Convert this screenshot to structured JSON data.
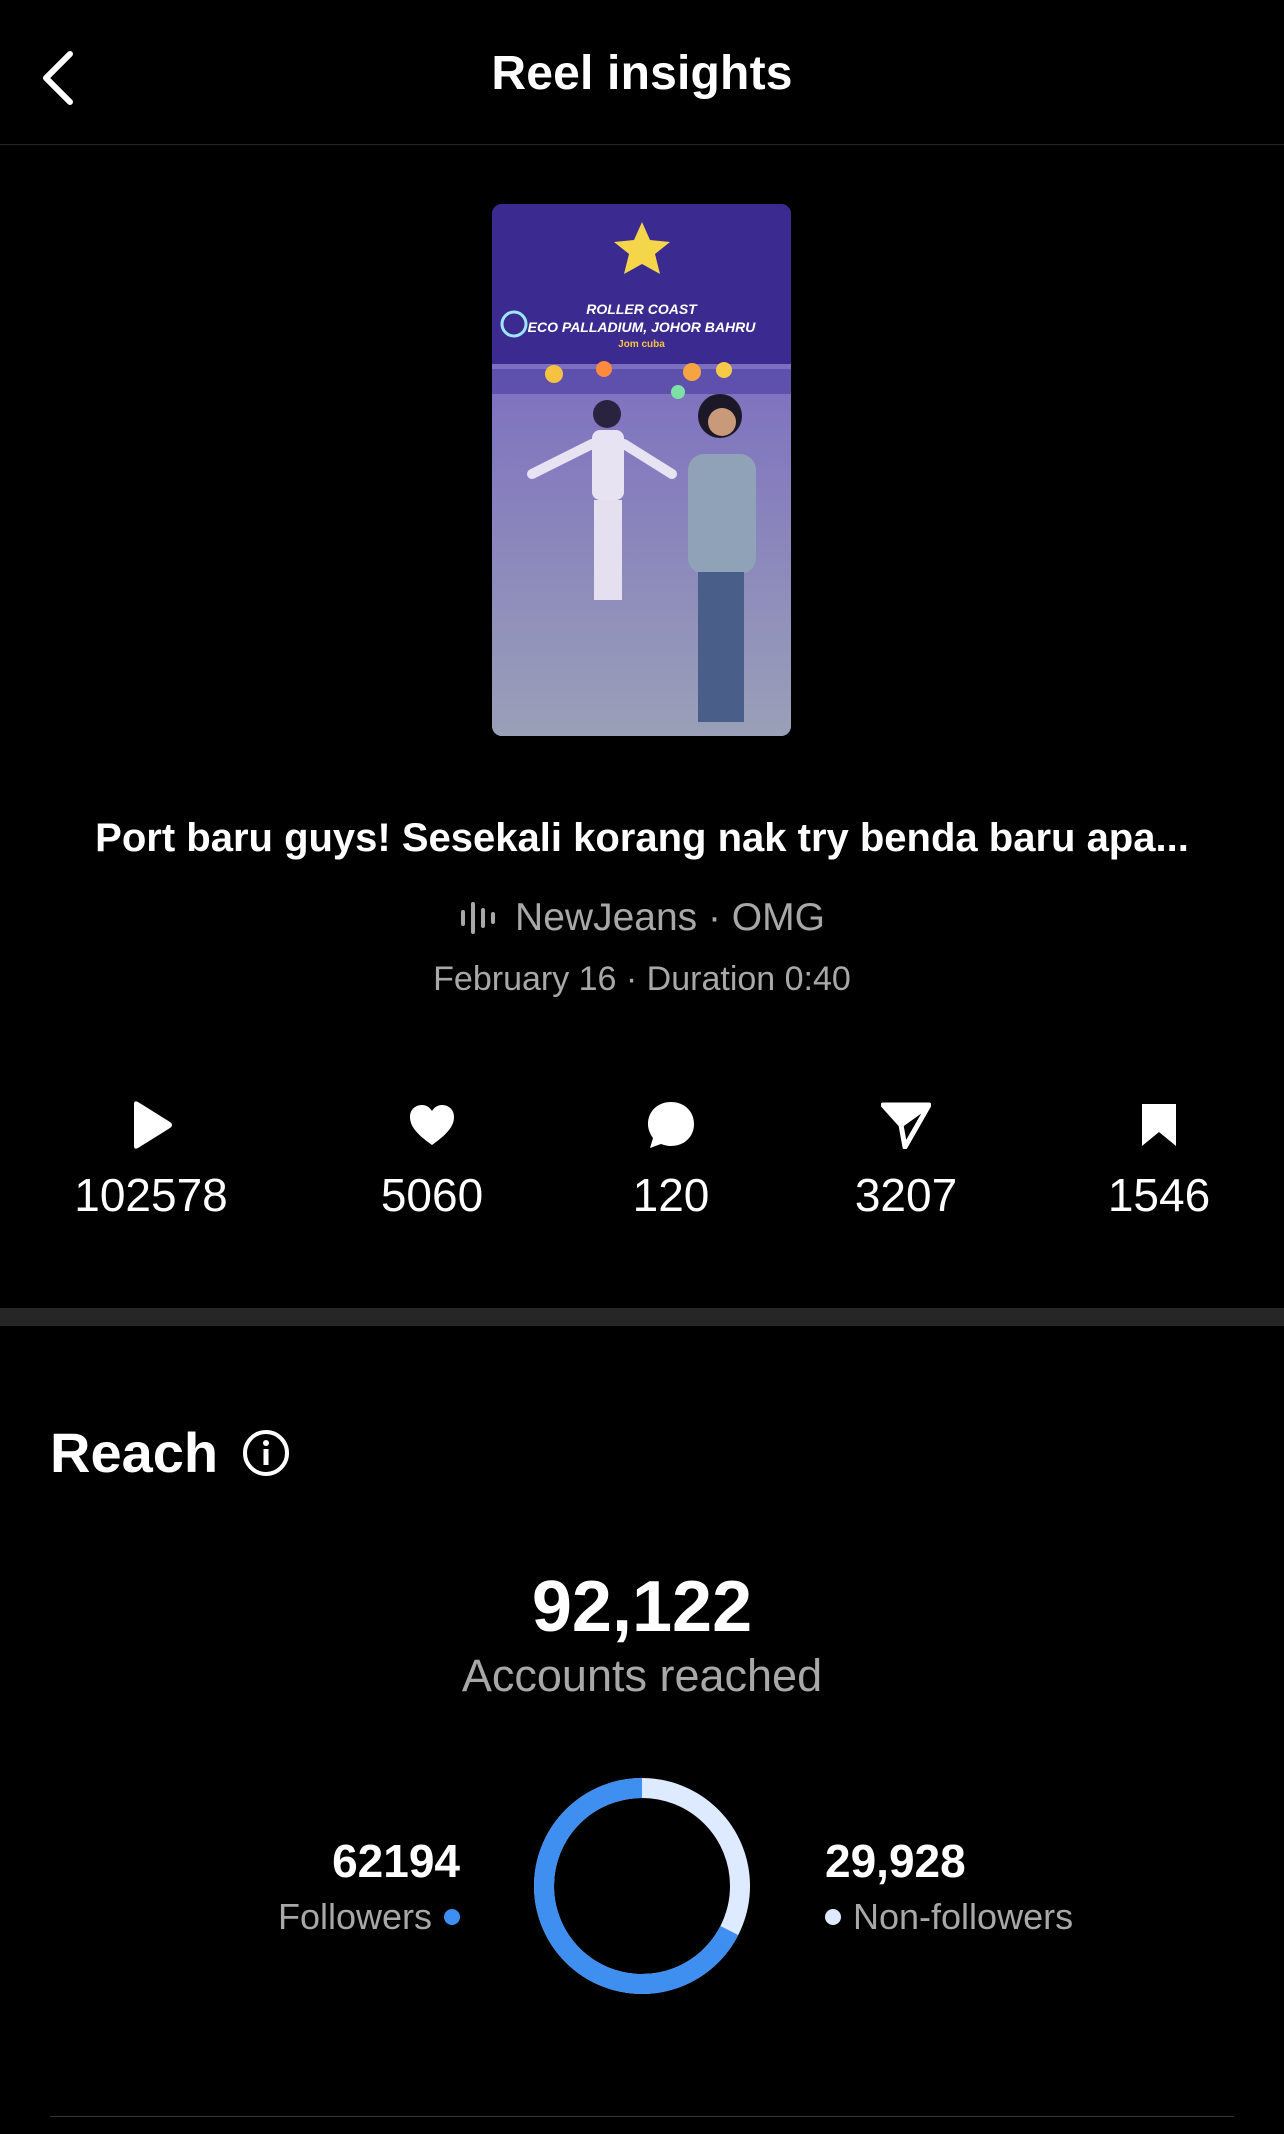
{
  "header": {
    "title": "Reel insights",
    "back_icon": "chevron-left-icon"
  },
  "reel": {
    "caption": "Port baru guys! Sesekali korang nak try benda baru apa...",
    "thumbnail_text": {
      "line1": "ROLLER COAST",
      "line2": "ECO PALLADIUM, JOHOR BAHRU",
      "line3": "Jom cuba"
    },
    "audio": "NewJeans · OMG",
    "meta": "February 16 · Duration 0:40"
  },
  "stats": [
    {
      "icon": "play-icon",
      "value": "102578"
    },
    {
      "icon": "heart-icon",
      "value": "5060"
    },
    {
      "icon": "comment-icon",
      "value": "120"
    },
    {
      "icon": "share-icon",
      "value": "3207"
    },
    {
      "icon": "bookmark-icon",
      "value": "1546"
    }
  ],
  "reach": {
    "title": "Reach",
    "accounts_reached": "92,122",
    "accounts_label": "Accounts reached",
    "followers": {
      "value": "62194",
      "label": "Followers",
      "color": "#3f8ff0"
    },
    "non_followers": {
      "value": "29,928",
      "label": "Non-followers",
      "color": "#deeaff"
    }
  }
}
